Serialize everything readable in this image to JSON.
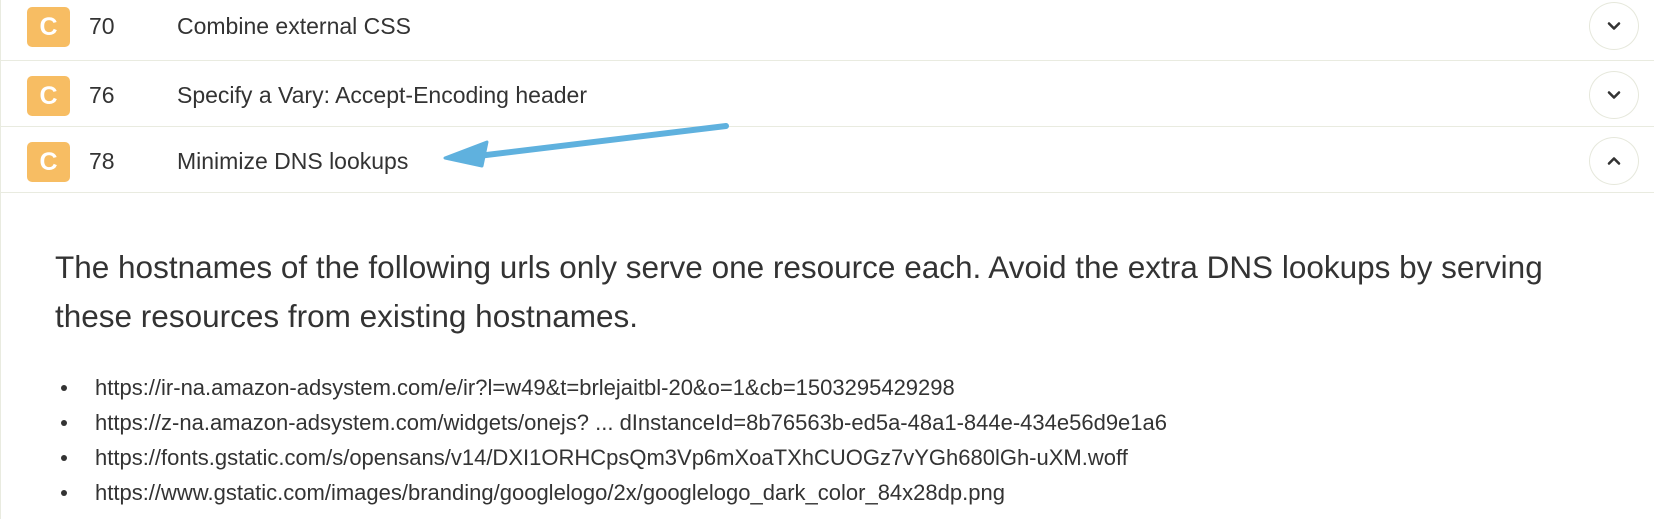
{
  "rules": [
    {
      "grade": "C",
      "score": "70",
      "title": "Combine external CSS",
      "expanded": false,
      "toggle_icon": "chevron-down-icon"
    },
    {
      "grade": "C",
      "score": "76",
      "title": "Specify a Vary: Accept-Encoding header",
      "expanded": false,
      "toggle_icon": "chevron-down-icon"
    },
    {
      "grade": "C",
      "score": "78",
      "title": "Minimize DNS lookups",
      "expanded": true,
      "toggle_icon": "chevron-up-icon"
    }
  ],
  "detail": {
    "description": "The hostnames of the following urls only serve one resource each. Avoid the extra DNS lookups by serving these resources from existing hostnames.",
    "urls": [
      "https://ir-na.amazon-adsystem.com/e/ir?l=w49&t=brlejaitbl-20&o=1&cb=1503295429298",
      "https://z-na.amazon-adsystem.com/widgets/onejs? ... dInstanceId=8b76563b-ed5a-48a1-844e-434e56d9e1a6",
      "https://fonts.gstatic.com/s/opensans/v14/DXI1ORHCpsQm3Vp6mXoaTXhCUOGz7vYGh680lGh-uXM.woff",
      "https://www.gstatic.com/images/branding/googlelogo/2x/googlelogo_dark_color_84x28dp.png"
    ]
  },
  "colors": {
    "grade_badge": "#f7bd63",
    "annotation_arrow": "#5fb1de",
    "divider": "#e9ebe0",
    "text": "#333333"
  }
}
